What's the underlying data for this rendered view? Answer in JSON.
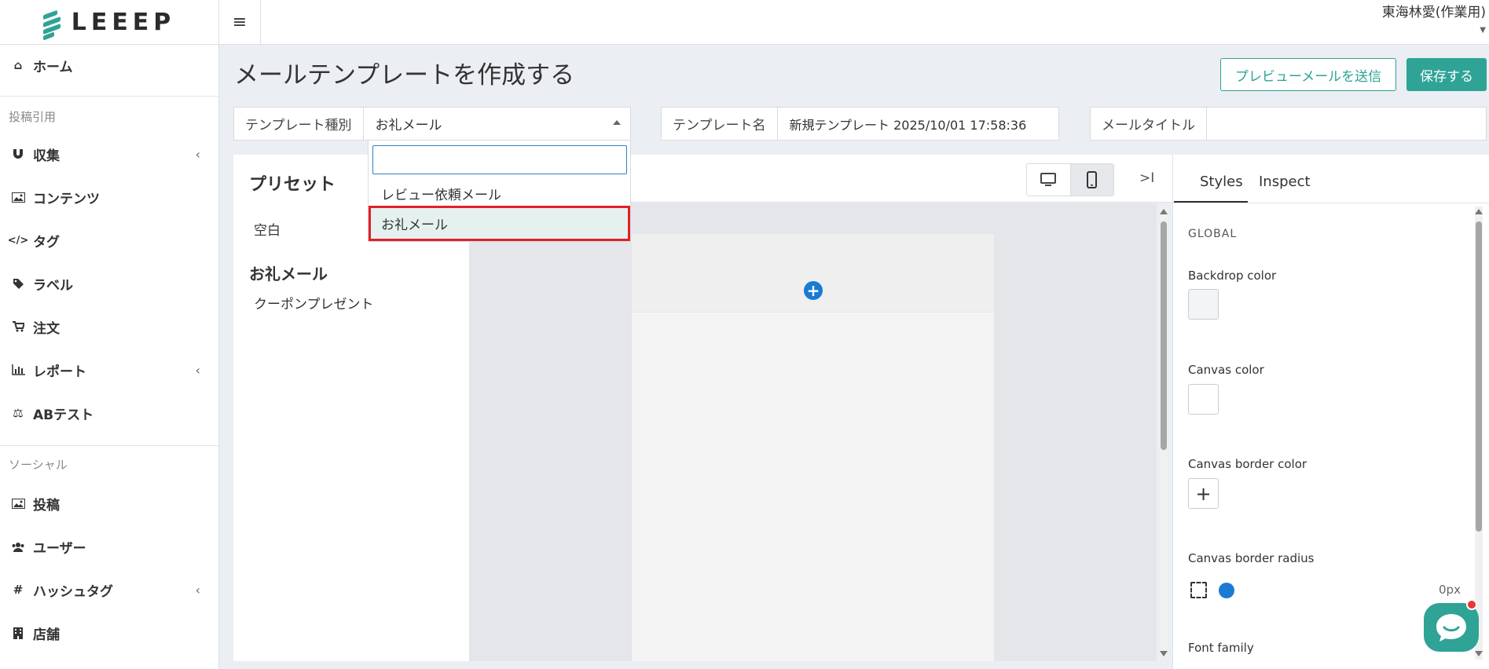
{
  "app": {
    "logo_text": "LEEEP",
    "user_name": "東海林愛(作業用)"
  },
  "sidebar": {
    "items": [
      {
        "label": "ホーム",
        "icon": "home-icon"
      },
      {
        "label": "収集",
        "icon": "magnet-icon",
        "has_chevron": true
      },
      {
        "label": "コンテンツ",
        "icon": "image-icon"
      },
      {
        "label": "タグ",
        "icon": "code-icon"
      },
      {
        "label": "ラベル",
        "icon": "tag-icon"
      },
      {
        "label": "注文",
        "icon": "cart-icon"
      },
      {
        "label": "レポート",
        "icon": "bar-chart-icon",
        "has_chevron": true
      },
      {
        "label": "ABテスト",
        "icon": "balance-scale-icon"
      },
      {
        "label": "投稿",
        "icon": "image-icon"
      },
      {
        "label": "ユーザー",
        "icon": "users-icon"
      },
      {
        "label": "ハッシュタグ",
        "icon": "hashtag-icon",
        "has_chevron": true
      },
      {
        "label": "店舗",
        "icon": "building-icon"
      }
    ],
    "sections": {
      "posting": "投稿引用",
      "social": "ソーシャル"
    },
    "chevron": "‹"
  },
  "header": {
    "title": "メールテンプレートを作成する",
    "preview_button": "プレビューメールを送信",
    "save_button": "保存する"
  },
  "fields": {
    "template_type": {
      "label": "テンプレート種別",
      "value": "お礼メール"
    },
    "template_name": {
      "label": "テンプレート名",
      "value": "新規テンプレート 2025/10/01 17:58:36"
    },
    "mail_title": {
      "label": "メールタイトル",
      "value": ""
    }
  },
  "dropdown": {
    "search_value": "",
    "options": [
      "レビュー依頼メール",
      "お礼メール"
    ],
    "selected": "お礼メール"
  },
  "presets": {
    "title": "プリセット",
    "blank": "空白",
    "group": "お礼メール",
    "items": [
      "クーポンプレゼント"
    ]
  },
  "editor": {
    "devices": [
      "desktop-icon",
      "mobile-icon"
    ],
    "active_device": "mobile-icon",
    "collapse_label": ">I"
  },
  "styles_panel": {
    "tabs": [
      "Styles",
      "Inspect"
    ],
    "active_tab": "Styles",
    "global_label": "GLOBAL",
    "backdrop_color_label": "Backdrop color",
    "backdrop_color": "#f2f4f5",
    "canvas_color_label": "Canvas color",
    "canvas_color": "#ffffff",
    "canvas_border_color_label": "Canvas border color",
    "canvas_border_radius_label": "Canvas border radius",
    "canvas_border_radius_value": "0px",
    "font_family_label": "Font family"
  },
  "colors": {
    "accent": "#2ea396",
    "selection_outline": "#e12027",
    "blue": "#1a7bd3"
  }
}
